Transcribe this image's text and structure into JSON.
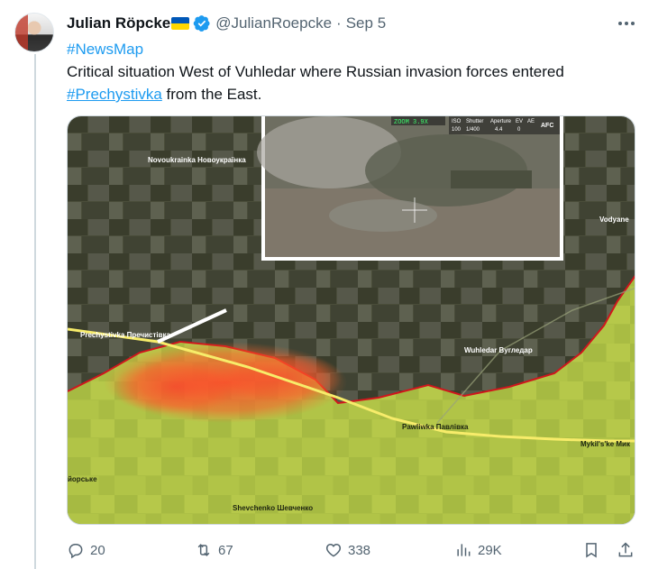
{
  "tweet": {
    "author_name": "Julian Röpcke",
    "author_handle": "@JulianRoepcke",
    "separator": "·",
    "date": "Sep 5",
    "flag": "ukraine-flag",
    "verified": true,
    "text_line1_hashtag": "#NewsMap",
    "text_line2": "Critical situation West of Vuhledar where Russian invasion forces entered",
    "text_line3_hashtag": "#Prechystivka",
    "text_line3_rest": " from the East."
  },
  "map": {
    "labels": {
      "novoukrainka": "Novoukrainka Новоукраїнка",
      "vodyane": "Vodyane",
      "prechystivka": "Prechystivka Пречистівка",
      "vuhledar": "Wuhledar Вугледар",
      "pawliwka": "Pawliwka Павлівка",
      "mykilske": "Mykil's'ke Мик",
      "yorske": "йорське",
      "shevchenko": "Shevchenko Шевченко"
    },
    "inset_hud": {
      "zoom": "ZOOM 3.9X",
      "iso_label": "ISO",
      "iso_value": "100",
      "shutter_label": "Shutter",
      "shutter_value": "1/400",
      "aperture_label": "Aperture",
      "aperture_value": "4.4",
      "ev_label": "EV",
      "ev_value": "0",
      "ae_label": "AE",
      "afc": "AFC"
    },
    "colors": {
      "occupied_fill": "#c6d84a",
      "front_line": "#d0161c",
      "attack_heat": "#ff3b2a",
      "road": "#f7ec6a"
    }
  },
  "actions": {
    "reply_count": "20",
    "repost_count": "67",
    "like_count": "338",
    "views_count": "29K"
  },
  "colors": {
    "accent": "#1d9bf0",
    "muted": "#536471",
    "verified": "#1d9bf0"
  }
}
